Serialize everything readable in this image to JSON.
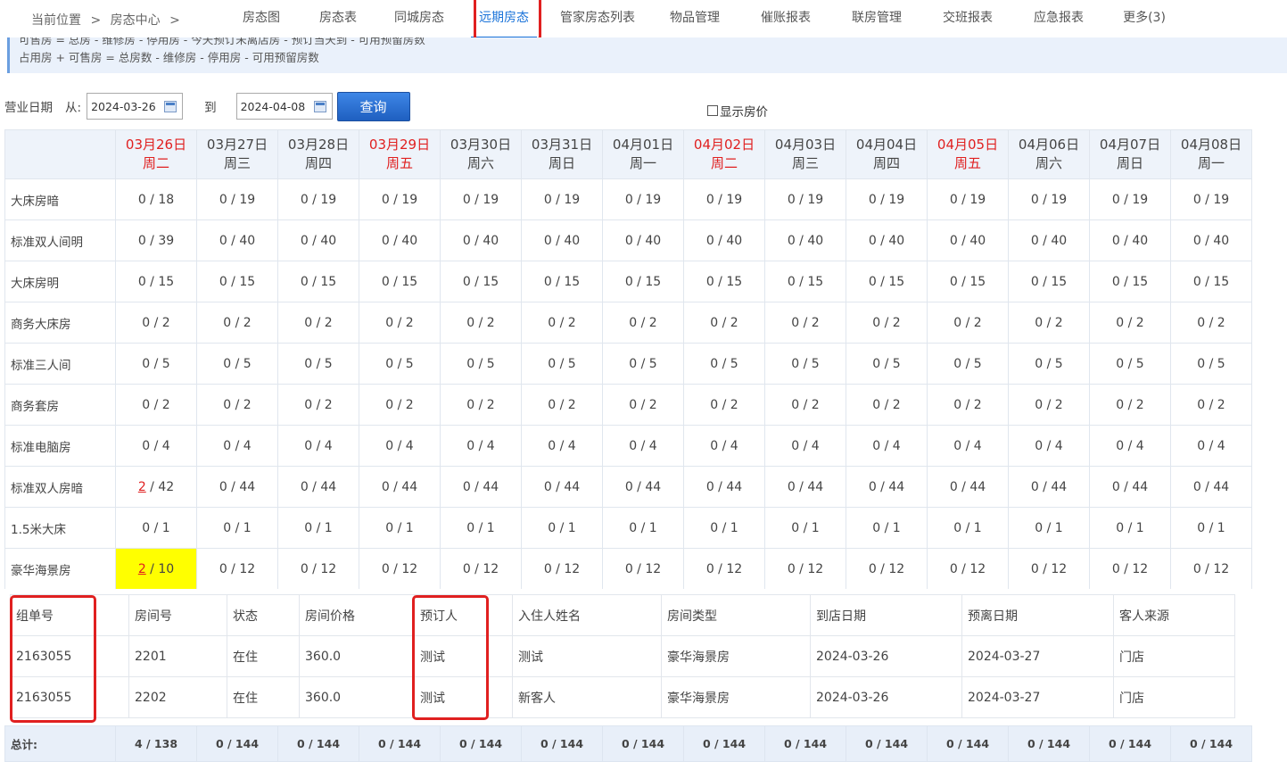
{
  "breadcrumb": {
    "label": "当前位置",
    "sep": ">",
    "current": "房态中心",
    "sep2": ">"
  },
  "tabs": [
    {
      "label": "房态图"
    },
    {
      "label": "房态表"
    },
    {
      "label": "同城房态"
    },
    {
      "label": "远期房态",
      "active": true
    },
    {
      "label": "管家房态列表"
    },
    {
      "label": "物品管理"
    },
    {
      "label": "催账报表"
    },
    {
      "label": "联房管理"
    },
    {
      "label": "交班报表"
    },
    {
      "label": "应急报表"
    },
    {
      "label": "更多(3)"
    }
  ],
  "info": {
    "line1": "可售房 = 总房 - 维修房 - 停用房 - 今天预订未离店房 - 预订当天到 - 可用预留房数",
    "line2": "占用房 + 可售房 = 总房数 - 维修房 - 停用房 - 可用预留房数"
  },
  "filter": {
    "label": "营业日期",
    "from_label": "从:",
    "from": "2024-03-26",
    "to_label": "到",
    "to": "2024-04-08",
    "query": "查询",
    "show_price": "显示房价"
  },
  "colors": {
    "accent": "#1a73d9",
    "red": "#e02020",
    "highlight": "#ffff00",
    "header_bg": "#eef3fa"
  },
  "dates": [
    {
      "d": "03月26日",
      "w": "周二",
      "red": true
    },
    {
      "d": "03月27日",
      "w": "周三"
    },
    {
      "d": "03月28日",
      "w": "周四"
    },
    {
      "d": "03月29日",
      "w": "周五",
      "red": true
    },
    {
      "d": "03月30日",
      "w": "周六"
    },
    {
      "d": "03月31日",
      "w": "周日"
    },
    {
      "d": "04月01日",
      "w": "周一"
    },
    {
      "d": "04月02日",
      "w": "周二",
      "red": true
    },
    {
      "d": "04月03日",
      "w": "周三"
    },
    {
      "d": "04月04日",
      "w": "周四"
    },
    {
      "d": "04月05日",
      "w": "周五",
      "red": true
    },
    {
      "d": "04月06日",
      "w": "周六"
    },
    {
      "d": "04月07日",
      "w": "周日"
    },
    {
      "d": "04月08日",
      "w": "周一"
    }
  ],
  "rooms": [
    {
      "type": "大床房暗",
      "first": "0 / 18",
      "rest": "0 / 19"
    },
    {
      "type": "标准双人间明",
      "first": "0 / 39",
      "rest": "0 / 40"
    },
    {
      "type": "大床房明",
      "first": "0 / 15",
      "rest": "0 / 15"
    },
    {
      "type": "商务大床房",
      "first": "0 / 2",
      "rest": "0 / 2"
    },
    {
      "type": "标准三人间",
      "first": "0 / 5",
      "rest": "0 / 5"
    },
    {
      "type": "商务套房",
      "first": "0 / 2",
      "rest": "0 / 2"
    },
    {
      "type": "标准电脑房",
      "first": "0 / 4",
      "rest": "0 / 4"
    },
    {
      "type": "标准双人房暗",
      "first_link": "2",
      "first_tail": " / 42",
      "rest": "0 / 44"
    },
    {
      "type": "1.5米大床",
      "first": "0 / 1",
      "rest": "0 / 1"
    },
    {
      "type": "豪华海景房",
      "first_link": "2",
      "first_tail": " / 10",
      "rest": "0 / 12",
      "highlight": true
    }
  ],
  "detail": {
    "headers": [
      "组单号",
      "房间号",
      "状态",
      "房间价格",
      "预订人",
      "入住人姓名",
      "房间类型",
      "到店日期",
      "预离日期",
      "客人来源"
    ],
    "rows": [
      [
        "2163055",
        "2201",
        "在住",
        "360.0",
        "测试",
        "测试",
        "豪华海景房",
        "2024-03-26",
        "2024-03-27",
        "门店"
      ],
      [
        "2163055",
        "2202",
        "在住",
        "360.0",
        "测试",
        "新客人",
        "豪华海景房",
        "2024-03-26",
        "2024-03-27",
        "门店"
      ]
    ]
  },
  "total": {
    "label": "总计:",
    "first": "4 / 138",
    "rest": "0 / 144"
  }
}
